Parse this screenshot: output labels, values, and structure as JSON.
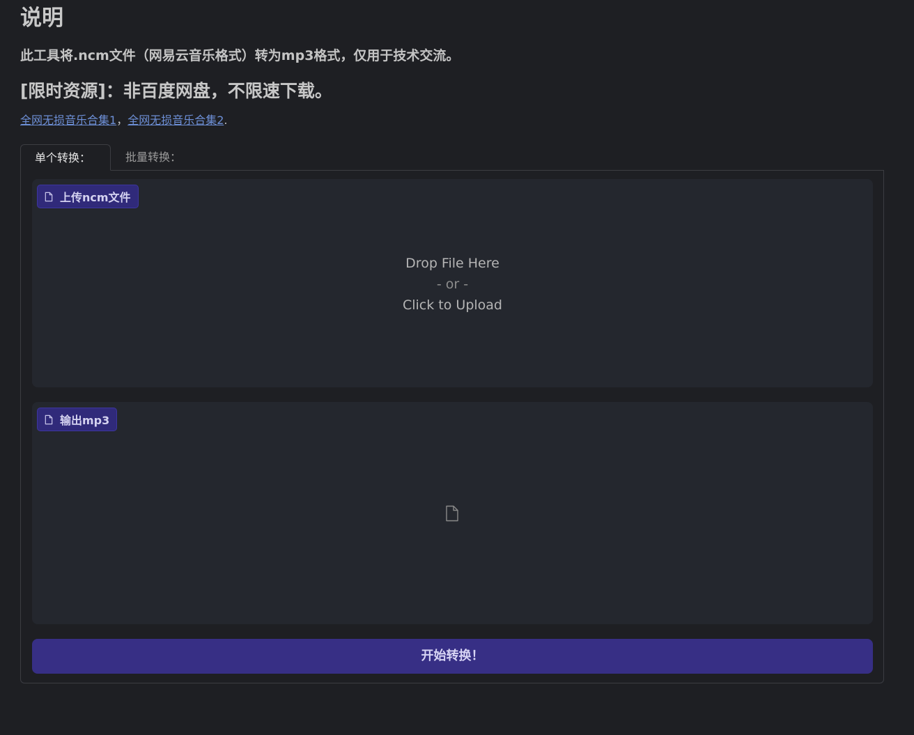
{
  "header": {
    "title": "说明",
    "description": "此工具将.ncm文件（网易云音乐格式）转为mp3格式，仅用于技术交流。",
    "promo": "[限时资源]：非百度网盘，不限速下载。",
    "links": [
      {
        "label": "全网无损音乐合集1"
      },
      {
        "label": "全网无损音乐合集2"
      }
    ],
    "link_separator": "，",
    "link_end": "."
  },
  "tabs": [
    {
      "label": "单个转换：",
      "active": true
    },
    {
      "label": "批量转换：",
      "active": false
    }
  ],
  "upload": {
    "label": "上传ncm文件",
    "icon": "file-icon",
    "drop_text": "Drop File Here",
    "or_text": "- or -",
    "click_text": "Click to Upload"
  },
  "output": {
    "label": "输出mp3",
    "icon": "file-icon",
    "empty_icon": "file-icon"
  },
  "convert_button": {
    "label": "开始转换！"
  },
  "colors": {
    "background": "#1e1f23",
    "panel": "#24272e",
    "accent": "#372f85",
    "link": "#6d8fd6"
  }
}
